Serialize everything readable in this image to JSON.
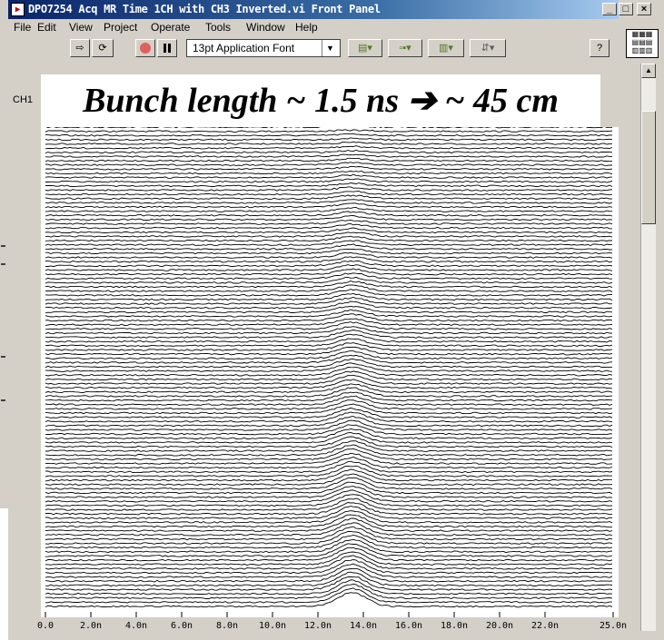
{
  "window": {
    "title": "DPO7254 Acq MR Time 1CH with CH3 Inverted.vi Front Panel",
    "buttons": {
      "minimize": "_",
      "maximize": "□",
      "close": "×"
    }
  },
  "menubar": {
    "items": [
      "File",
      "Edit",
      "View",
      "Project",
      "Operate",
      "Tools",
      "Window",
      "Help"
    ]
  },
  "toolbar": {
    "font": "13pt Application Font",
    "icons": [
      "run-arrow-icon",
      "run-continuous-icon",
      "abort-icon",
      "pause-icon",
      "align-icon",
      "distribute-icon",
      "resize-icon",
      "reorder-icon",
      "help-icon"
    ]
  },
  "panel": {
    "label": "CH1",
    "banner": "Bunch length ~ 1.5 ns ➔ ~ 45 cm"
  },
  "chart_data": {
    "type": "line",
    "title": "",
    "x_ticks": [
      "0.0",
      "2.0n",
      "4.0n",
      "6.0n",
      "8.0n",
      "10.0n",
      "12.0n",
      "14.0n",
      "16.0n",
      "18.0n",
      "20.0n",
      "22.0n",
      "25.0n"
    ],
    "xlim": [
      0,
      25
    ],
    "trace_count": 115,
    "pulse_center": 13.5,
    "pulse_width": 1.5,
    "colors": {
      "trace": "#000000",
      "background": "#ffffff"
    }
  }
}
